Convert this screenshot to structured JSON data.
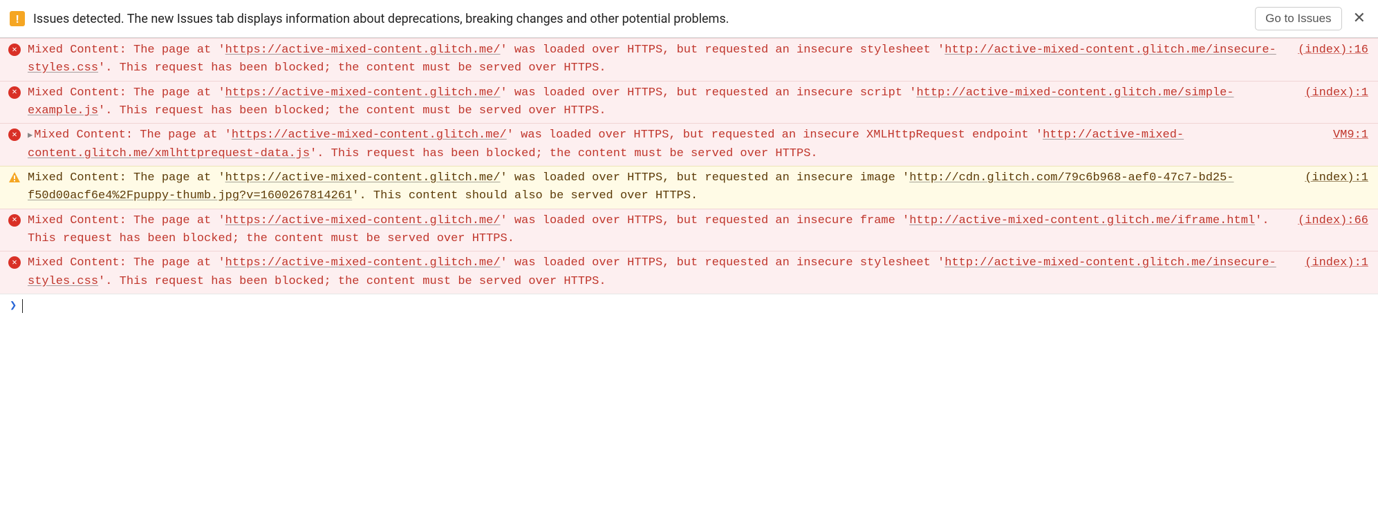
{
  "issues_bar": {
    "icon_glyph": "!",
    "text": "Issues detected. The new Issues tab displays information about deprecations, breaking changes and other potential problems.",
    "button_label": "Go to Issues",
    "close_glyph": "✕"
  },
  "prompt": {
    "caret": "❯"
  },
  "entries": [
    {
      "level": "error",
      "expandable": false,
      "source": "(index):16",
      "parts": [
        {
          "t": "Mixed Content: The page at '"
        },
        {
          "t": "https://active-mixed-content.glitch.me/",
          "url": true
        },
        {
          "t": "' was loaded over HTTPS, but requested an insecure stylesheet '"
        },
        {
          "t": "http://active-mixed-content.glitch.me/insecure-styles.css",
          "url": true
        },
        {
          "t": "'. This request has been blocked; the content must be served over HTTPS."
        }
      ]
    },
    {
      "level": "error",
      "expandable": false,
      "source": "(index):1",
      "parts": [
        {
          "t": "Mixed Content: The page at '"
        },
        {
          "t": "https://active-mixed-content.glitch.me/",
          "url": true
        },
        {
          "t": "' was loaded over HTTPS, but requested an insecure script '"
        },
        {
          "t": "http://active-mixed-content.glitch.me/simple-example.js",
          "url": true
        },
        {
          "t": "'. This request has been blocked; the content must be served over HTTPS."
        }
      ]
    },
    {
      "level": "error",
      "expandable": true,
      "source": "VM9:1",
      "parts": [
        {
          "t": "Mixed Content: The page at '"
        },
        {
          "t": "https://active-mixed-content.glitch.me/",
          "url": true
        },
        {
          "t": "' was loaded over HTTPS, but requested an insecure XMLHttpRequest endpoint '"
        },
        {
          "t": "http://active-mixed-content.glitch.me/xmlhttprequest-data.js",
          "url": true
        },
        {
          "t": "'. This request has been blocked; the content must be served over HTTPS."
        }
      ]
    },
    {
      "level": "warning",
      "expandable": false,
      "source": "(index):1",
      "parts": [
        {
          "t": "Mixed Content: The page at '"
        },
        {
          "t": "https://active-mixed-content.glitch.me/",
          "url": true
        },
        {
          "t": "' was loaded over HTTPS, but requested an insecure image '"
        },
        {
          "t": "http://cdn.glitch.com/79c6b968-aef0-47c7-bd25-f50d00acf6e4%2Fpuppy-thumb.jpg?v=1600267814261",
          "url": true
        },
        {
          "t": "'. This content should also be served over HTTPS."
        }
      ]
    },
    {
      "level": "error",
      "expandable": false,
      "source": "(index):66",
      "parts": [
        {
          "t": "Mixed Content: The page at '"
        },
        {
          "t": "https://active-mixed-content.glitch.me/",
          "url": true
        },
        {
          "t": "' was loaded over HTTPS, but requested an insecure frame '"
        },
        {
          "t": "http://active-mixed-content.glitch.me/iframe.html",
          "url": true
        },
        {
          "t": "'. This request has been blocked; the content must be served over HTTPS."
        }
      ]
    },
    {
      "level": "error",
      "expandable": false,
      "source": "(index):1",
      "parts": [
        {
          "t": "Mixed Content: The page at '"
        },
        {
          "t": "https://active-mixed-content.glitch.me/",
          "url": true
        },
        {
          "t": "' was loaded over HTTPS, but requested an insecure stylesheet '"
        },
        {
          "t": "http://active-mixed-content.glitch.me/insecure-styles.css",
          "url": true
        },
        {
          "t": "'. This request has been blocked; the content must be served over HTTPS."
        }
      ]
    }
  ]
}
